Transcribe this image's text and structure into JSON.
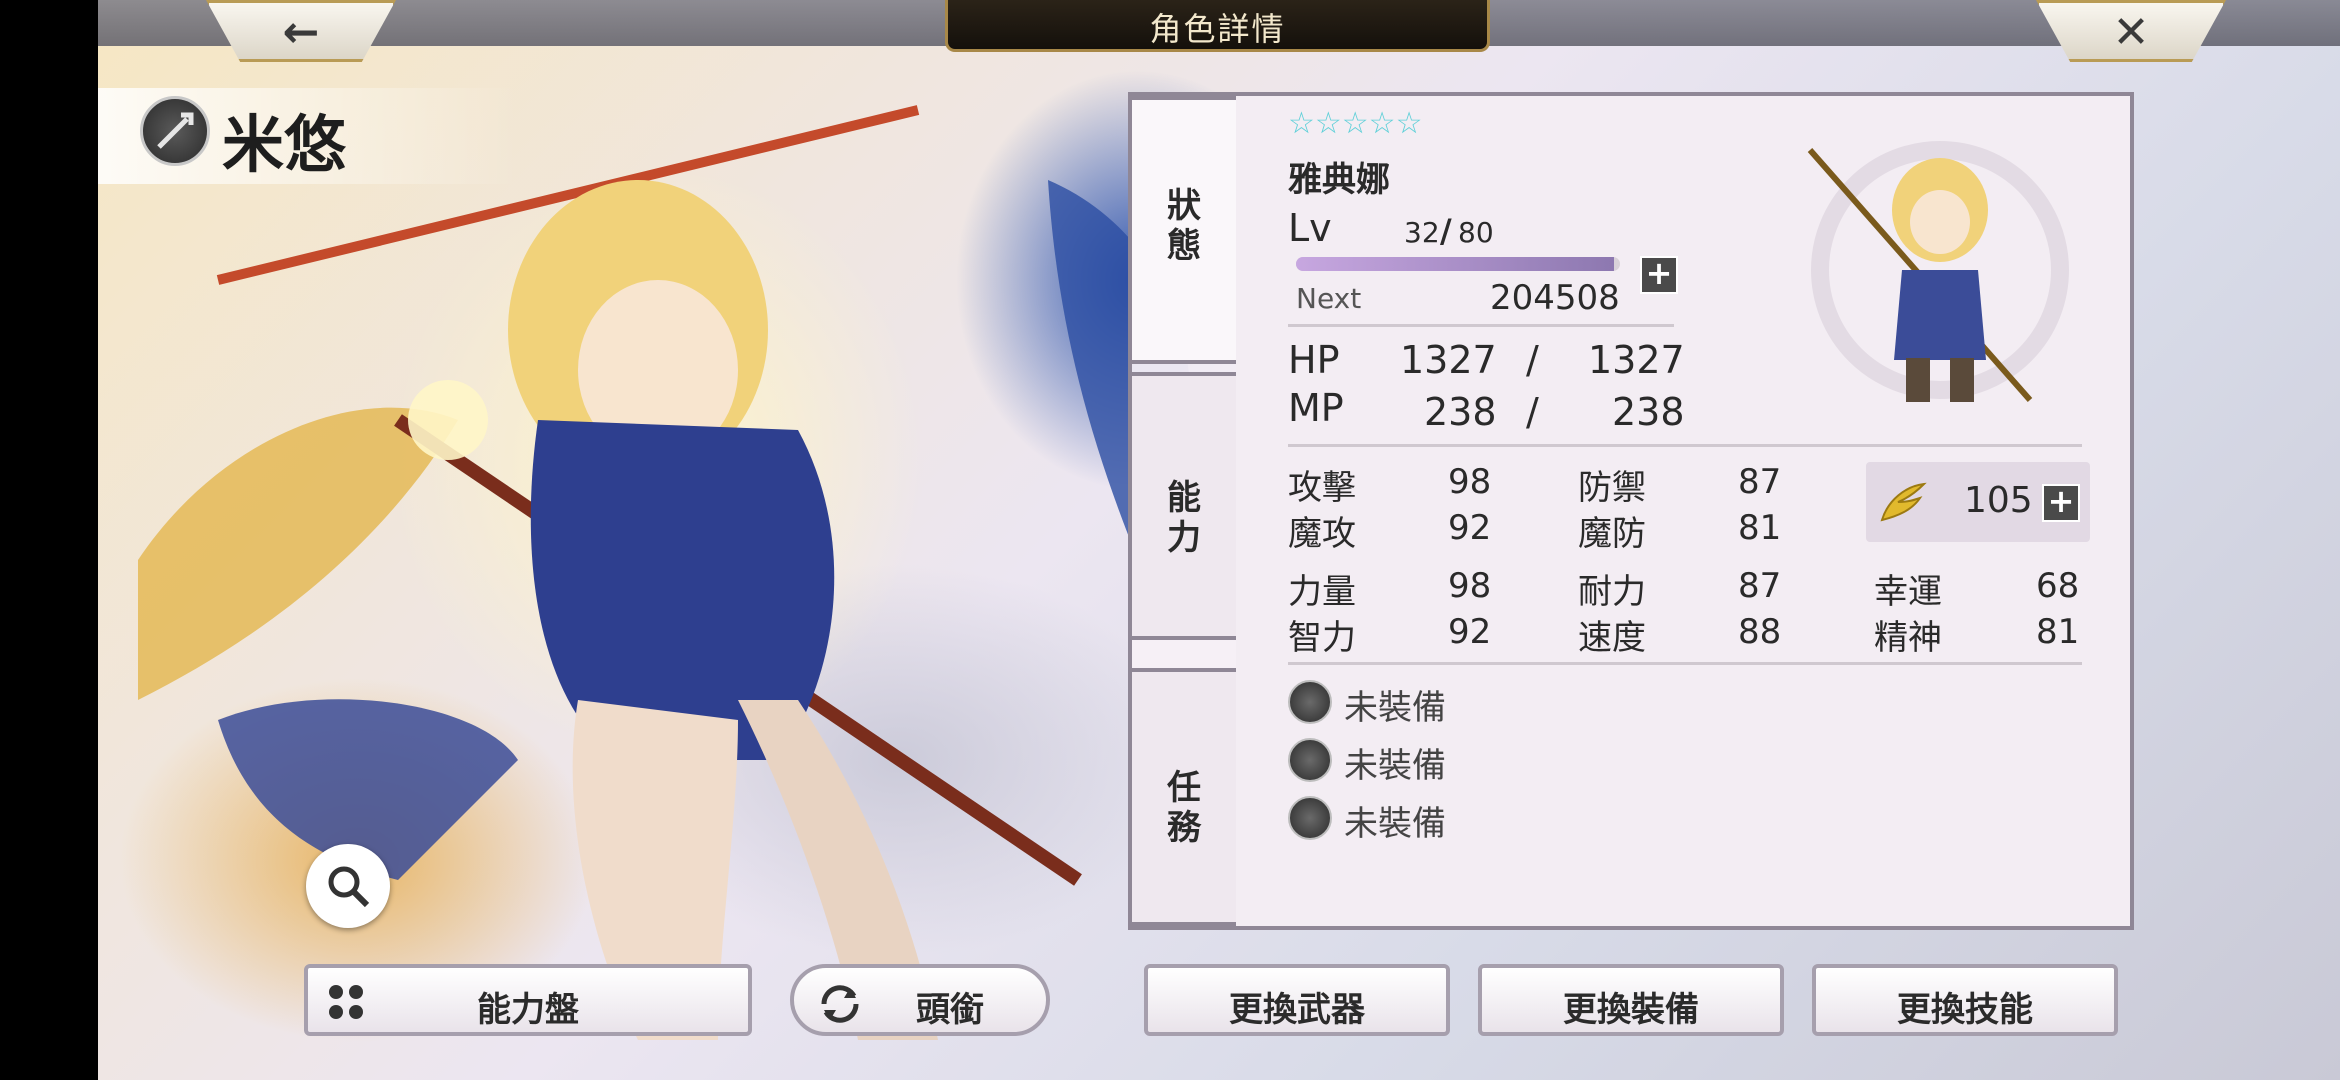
{
  "header": {
    "title": "角色詳情",
    "back_icon": "back-arrow-icon",
    "close_icon": "close-x-icon"
  },
  "character": {
    "name": "米悠",
    "class_icon": "spear-class-icon"
  },
  "tabs": [
    {
      "label": "狀\n態",
      "active": true
    },
    {
      "label": "能\n力",
      "active": false
    },
    {
      "label": "任\n務",
      "active": false
    }
  ],
  "unit": {
    "rarity_stars": "☆☆☆☆☆",
    "title": "雅典娜",
    "level_label": "Lv",
    "level": "32",
    "level_sep": "/",
    "level_max": "80",
    "next_label": "Next",
    "next_exp": "204508",
    "exp_progress": 0.98
  },
  "vitals": {
    "hp_label": "HP",
    "hp": "1327",
    "hp_sep": "/",
    "hp_max": "1327",
    "mp_label": "MP",
    "mp": "238",
    "mp_sep": "/",
    "mp_max": "238"
  },
  "combat_stats": [
    {
      "label": "攻擊",
      "value": "98"
    },
    {
      "label": "防禦",
      "value": "87"
    },
    {
      "label": "魔攻",
      "value": "92"
    },
    {
      "label": "魔防",
      "value": "81"
    }
  ],
  "soul": {
    "icon": "wing-icon",
    "value": "105"
  },
  "attributes": [
    {
      "label": "力量",
      "value": "98"
    },
    {
      "label": "耐力",
      "value": "87"
    },
    {
      "label": "幸運",
      "value": "68"
    },
    {
      "label": "智力",
      "value": "92"
    },
    {
      "label": "速度",
      "value": "88"
    },
    {
      "label": "精神",
      "value": "81"
    }
  ],
  "equipment": [
    {
      "icon": "weapon-slot-icon",
      "label": "未裝備"
    },
    {
      "icon": "armor-slot-icon",
      "label": "未裝備"
    },
    {
      "icon": "accessory-slot-icon",
      "label": "未裝備"
    }
  ],
  "buttons": {
    "ability_board": "能力盤",
    "title_btn": "頭銜",
    "change_weapon": "更換武器",
    "change_equipment": "更換裝備",
    "change_skill": "更換技能"
  },
  "colors": {
    "accent_gold": "#b99b55",
    "panel_border": "#8f8796",
    "star_cyan": "#5fd0d8"
  }
}
